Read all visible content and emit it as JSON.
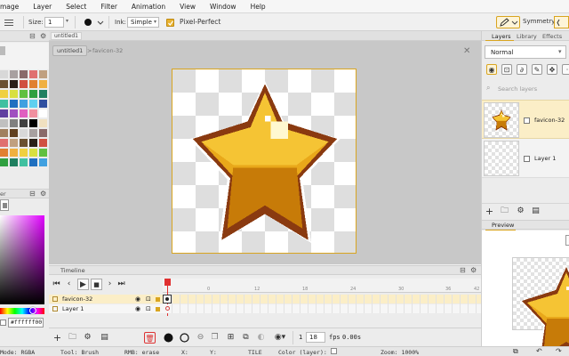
{
  "menu": [
    "mage",
    "Layer",
    "Select",
    "Filter",
    "Animation",
    "View",
    "Window",
    "Help"
  ],
  "toolbar": {
    "size_label": "Size:",
    "size_value": "1",
    "ink_label": "Ink:",
    "ink_value": "Simple",
    "pixel_perfect_label": "Pixel-Perfect",
    "symmetry_label": "Symmetry:"
  },
  "left_panel": {
    "color_panel_label": "er",
    "hex_value": "#ffffff00"
  },
  "document": {
    "tab_label": "untitled1",
    "breadcrumb_file": "untitled1",
    "breadcrumb_sep": ">",
    "breadcrumb_layer": "favicon-32"
  },
  "timeline": {
    "title": "Timeline",
    "frame_ticks": [
      "0",
      "12",
      "18",
      "24",
      "30",
      "36",
      "42"
    ],
    "layers": [
      {
        "name": "favicon-32"
      },
      {
        "name": "Layer 1"
      }
    ]
  },
  "bottom_bar": {
    "frame_index": "1",
    "fps_value": "18",
    "fps_label": "fps",
    "time_value": "0.00s"
  },
  "status_bar": {
    "mode": "Mode: RGBA",
    "tool": "Tool: Brush",
    "rmb": "RMB: erase",
    "x": "X:",
    "y": "Y:",
    "tile": "TILE",
    "color_layer": "Color (layer):",
    "zoom": "Zoom: 1000%"
  },
  "right_panel": {
    "tabs": [
      "Layers",
      "Library",
      "Effects"
    ],
    "blend_mode": "Normal",
    "search_placeholder": "Search layers",
    "layers": [
      {
        "name": "favicon-32"
      },
      {
        "name": "Layer 1"
      }
    ],
    "preview_label": "Preview"
  },
  "colors": {
    "accent": "#e8b230",
    "star_light": "#f5c434",
    "star_mid": "#e9a81a",
    "star_dark": "#c77b08",
    "star_outline": "#8a3a10",
    "highlight": "#fff8d0"
  }
}
